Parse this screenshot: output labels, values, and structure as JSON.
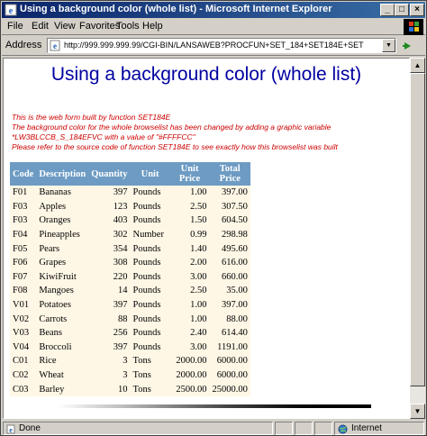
{
  "window": {
    "title": "Using a background color (whole list) - Microsoft Internet Explorer",
    "buttons": {
      "minimize": "_",
      "maximize": "□",
      "close": "×"
    }
  },
  "menu": [
    "File",
    "Edit",
    "View",
    "Favorites",
    "Tools",
    "Help"
  ],
  "address": {
    "label": "Address",
    "url": "http://999.999.999.99/CGI-BIN/LANSAWEB?PROCFUN+SET_184+SET184E+SET"
  },
  "page": {
    "heading": "Using a background color (whole list)",
    "notes": [
      "This is the web form built by function SET184E",
      "The background color for the whole browselist has been changed by adding a graphic variable",
      "*LW3BLCCB_S_184EFVC with a value of \"#FFFFCC\"",
      "Please refer to the source code of function SET184E to see exactly how this browselist was built"
    ],
    "table": {
      "headers": [
        "Code",
        "Description",
        "Quantity",
        "Unit",
        "Unit Price",
        "Total Price"
      ],
      "rows": [
        [
          "F01",
          "Bananas",
          "397",
          "Pounds",
          "1.00",
          "397.00"
        ],
        [
          "F03",
          "Apples",
          "123",
          "Pounds",
          "2.50",
          "307.50"
        ],
        [
          "F03",
          "Oranges",
          "403",
          "Pounds",
          "1.50",
          "604.50"
        ],
        [
          "F04",
          "Pineapples",
          "302",
          "Number",
          "0.99",
          "298.98"
        ],
        [
          "F05",
          "Pears",
          "354",
          "Pounds",
          "1.40",
          "495.60"
        ],
        [
          "F06",
          "Grapes",
          "308",
          "Pounds",
          "2.00",
          "616.00"
        ],
        [
          "F07",
          "KiwiFruit",
          "220",
          "Pounds",
          "3.00",
          "660.00"
        ],
        [
          "F08",
          "Mangoes",
          "14",
          "Pounds",
          "2.50",
          "35.00"
        ],
        [
          "V01",
          "Potatoes",
          "397",
          "Pounds",
          "1.00",
          "397.00"
        ],
        [
          "V02",
          "Carrots",
          "88",
          "Pounds",
          "1.00",
          "88.00"
        ],
        [
          "V03",
          "Beans",
          "256",
          "Pounds",
          "2.40",
          "614.40"
        ],
        [
          "V04",
          "Broccoli",
          "397",
          "Pounds",
          "3.00",
          "1191.00"
        ],
        [
          "C01",
          "Rice",
          "3",
          "Tons",
          "2000.00",
          "6000.00"
        ],
        [
          "C02",
          "Wheat",
          "3",
          "Tons",
          "2000.00",
          "6000.00"
        ],
        [
          "C03",
          "Barley",
          "10",
          "Tons",
          "2500.00",
          "25000.00"
        ]
      ]
    }
  },
  "status": {
    "left": "Done",
    "zone": "Internet"
  },
  "colors": {
    "heading": "#0000a0",
    "notes": "#cc0000",
    "header_bg": "#6d9bc3",
    "row_bg": "#fff7e6",
    "titlebar": "#0a246a"
  },
  "icons": [
    "ie-page-icon",
    "minimize-icon",
    "maximize-icon",
    "close-icon",
    "windows-logo-icon",
    "go-arrow-icon",
    "dropdown-arrow-icon",
    "scroll-up-icon",
    "scroll-down-icon",
    "globe-icon"
  ]
}
